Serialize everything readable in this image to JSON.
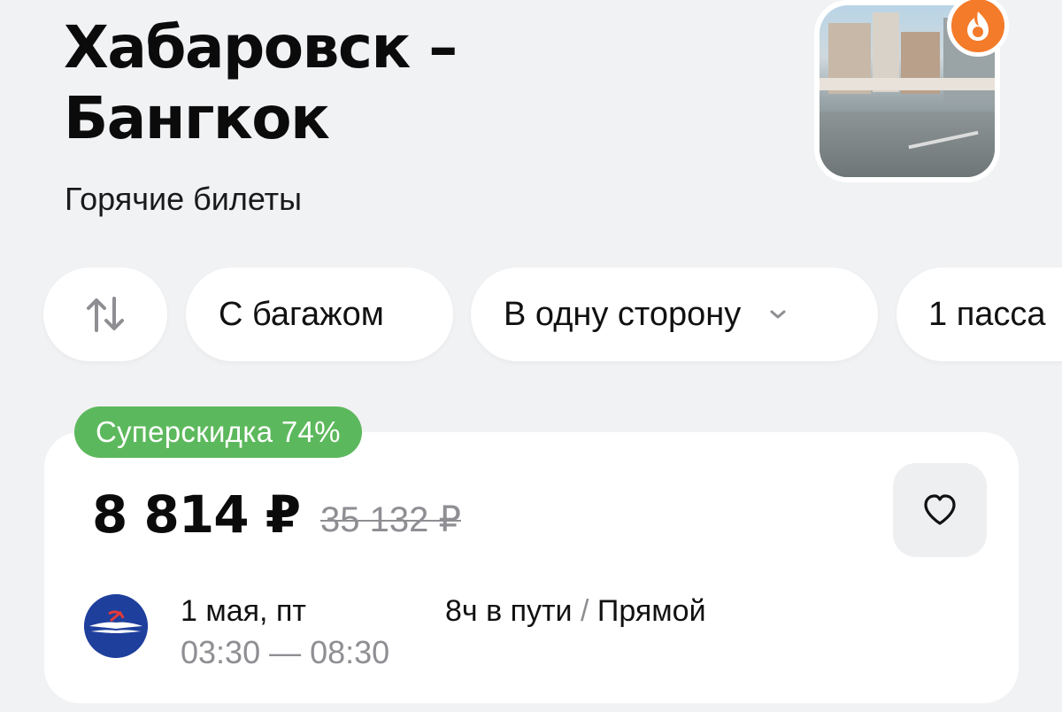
{
  "header": {
    "title_line1": "Хабаровск –",
    "title_line2": "Бангкок",
    "subtitle": "Горячие билеты"
  },
  "filters": {
    "swap_icon": "swap-vertical-icon",
    "baggage": "С багажом",
    "trip_type": "В одну сторону",
    "passengers": "1 пасса"
  },
  "ticket": {
    "discount_label": "Суперскидка 74%",
    "price": "8 814 ₽",
    "old_price": "35 132 ₽",
    "date": "1 мая, пт",
    "times": "03:30 — 08:30",
    "duration": "8ч в пути",
    "duration_sep": " / ",
    "stops": "Прямой",
    "airline_icon": "aeroflot-logo-icon",
    "favorite_icon": "heart-icon"
  },
  "colors": {
    "background": "#f1f2f4",
    "discount_green": "#5cb85c",
    "hot_orange": "#f47b2a",
    "airline_blue": "#1f3f9c"
  }
}
